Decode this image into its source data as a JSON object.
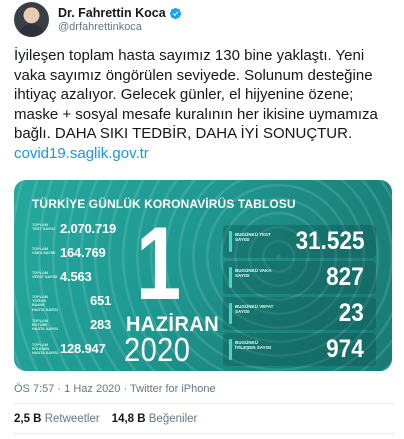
{
  "author": {
    "name": "Dr. Fahrettin Koca",
    "handle": "@drfahrettinkoca",
    "verified_icon": "verified-badge-icon",
    "verified_color": "#1da1f2"
  },
  "tweet": {
    "lines": [
      "İyileşen toplam hasta sayımız 130 bine yaklaştı. Yeni",
      "vaka sayımız öngörülen seviyede. Solunum desteğine",
      "ihtiyaç azalıyor. Gelecek günler, el hijyenine özene;",
      "maske + sosyal mesafe kuralının her ikisine uymamıza",
      "bağlı. DAHA SIKI TEDBİR, DAHA İYİ SONUÇTUR."
    ],
    "link": "covid19.saglik.gov.tr",
    "link_color": "#1b95e0"
  },
  "media": {
    "title": "TÜRKİYE GÜNLÜK KORONAVİRÜS TABLOSU",
    "day": "1",
    "month": "HAZİRAN",
    "year": "2020",
    "background_color": "#1f9a93",
    "left_stats": [
      {
        "label": "TOPLAM TEST SAYISI",
        "value": "2.070.719"
      },
      {
        "label": "TOPLAM VAKA SAYISI",
        "value": "164.769"
      },
      {
        "label": "TOPLAM VEFAT SAYISI",
        "value": "4.563"
      },
      {
        "label": "TOPLAM YOĞUN BAKIM HASTA SAYISI",
        "value": "651"
      },
      {
        "label": "TOPLAM ENTÜBE HASTA SAYISI",
        "value": "283"
      },
      {
        "label": "TOPLAM İYİLEŞEN HASTA SAYISI",
        "value": "128.947"
      }
    ],
    "right_panels": [
      {
        "label": "BUGÜNKÜ TEST SAYISI",
        "value": "31.525"
      },
      {
        "label": "BUGÜNKÜ VAKA SAYISI",
        "value": "827"
      },
      {
        "label": "BUGÜNKÜ VEFAT SAYISI",
        "value": "23"
      },
      {
        "label": "BUGÜNKÜ İYİLEŞEN SAYISI",
        "value": "974"
      }
    ]
  },
  "meta": {
    "time": "ÖS 7:57",
    "date": "1 Haz 2020",
    "source": "Twitter for iPhone"
  },
  "counts": {
    "retweets_value": "2,5 B",
    "retweets_label": "Retweetler",
    "likes_value": "14,8 B",
    "likes_label": "Beğeniler"
  }
}
